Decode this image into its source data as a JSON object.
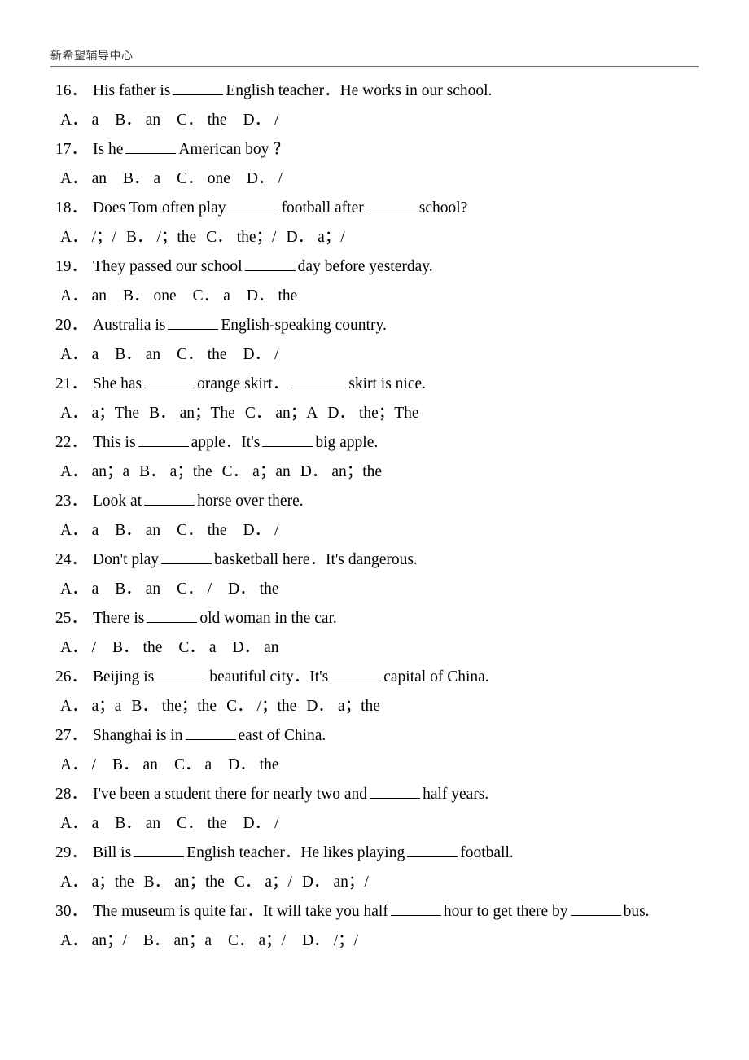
{
  "header": {
    "title": "新希望辅导中心"
  },
  "questions": [
    {
      "number": "16．",
      "stem_parts": [
        "His father is ",
        "blank",
        " English teacher．He works in our school."
      ],
      "blank_widths": [
        62
      ],
      "tight": false,
      "options": [
        {
          "label": "A．",
          "text": "a"
        },
        {
          "label": "B．",
          "text": "an"
        },
        {
          "label": "C．",
          "text": "the"
        },
        {
          "label": "D．",
          "text": "/"
        }
      ]
    },
    {
      "number": "17．",
      "stem_parts": [
        "Is he ",
        "blank",
        " American boy ？"
      ],
      "blank_widths": [
        62
      ],
      "tight": false,
      "options": [
        {
          "label": "A．",
          "text": "an"
        },
        {
          "label": "B．",
          "text": "a"
        },
        {
          "label": "C．",
          "text": "one"
        },
        {
          "label": "D．",
          "text": "/"
        }
      ]
    },
    {
      "number": "18．",
      "stem_parts": [
        "Does Tom often play ",
        "blank",
        " football after ",
        "blank",
        " school?"
      ],
      "blank_widths": [
        62,
        62
      ],
      "tight": true,
      "options": [
        {
          "label": "A．",
          "text": "/；/"
        },
        {
          "label": "B．",
          "text": "/；the"
        },
        {
          "label": "C．",
          "text": "the；/"
        },
        {
          "label": "D．",
          "text": "a；/"
        }
      ]
    },
    {
      "number": "19．",
      "stem_parts": [
        "They passed our school ",
        "blank",
        " day before yesterday."
      ],
      "blank_widths": [
        62
      ],
      "tight": false,
      "options": [
        {
          "label": "A．",
          "text": "an"
        },
        {
          "label": "B．",
          "text": "one"
        },
        {
          "label": "C．",
          "text": "a"
        },
        {
          "label": "D．",
          "text": "the"
        }
      ]
    },
    {
      "number": "20．",
      "stem_parts": [
        "Australia is ",
        "blank",
        " English-speaking country."
      ],
      "blank_widths": [
        62
      ],
      "tight": false,
      "options": [
        {
          "label": "A．",
          "text": "a"
        },
        {
          "label": "B．",
          "text": "an"
        },
        {
          "label": "C．",
          "text": "the"
        },
        {
          "label": "D．",
          "text": "/"
        }
      ]
    },
    {
      "number": "21．",
      "stem_parts": [
        "She has ",
        "blank",
        " orange skirt．",
        "blank",
        " skirt is nice."
      ],
      "blank_widths": [
        62,
        68
      ],
      "tight": true,
      "options": [
        {
          "label": "A．",
          "text": "a；The"
        },
        {
          "label": "B．",
          "text": "an；The"
        },
        {
          "label": "C．",
          "text": "an；A"
        },
        {
          "label": "D．",
          "text": "the；The"
        }
      ]
    },
    {
      "number": "22．",
      "stem_parts": [
        "This is ",
        "blank",
        " apple．It's ",
        "blank",
        " big apple."
      ],
      "blank_widths": [
        62,
        62
      ],
      "tight": true,
      "options": [
        {
          "label": "A．",
          "text": "an；a"
        },
        {
          "label": "B．",
          "text": "a；the"
        },
        {
          "label": "C．",
          "text": "a；an"
        },
        {
          "label": "D．",
          "text": "an；the"
        }
      ]
    },
    {
      "number": "23．",
      "stem_parts": [
        "Look at ",
        "blank",
        " horse over there."
      ],
      "blank_widths": [
        62
      ],
      "tight": false,
      "options": [
        {
          "label": "A．",
          "text": "a"
        },
        {
          "label": "B．",
          "text": "an"
        },
        {
          "label": "C．",
          "text": "the"
        },
        {
          "label": "D．",
          "text": "/"
        }
      ]
    },
    {
      "number": "24．",
      "stem_parts": [
        "Don't play ",
        "blank",
        " basketball here．It's dangerous."
      ],
      "blank_widths": [
        62
      ],
      "tight": false,
      "options": [
        {
          "label": "A．",
          "text": "a"
        },
        {
          "label": "B．",
          "text": "an"
        },
        {
          "label": "C．",
          "text": "/"
        },
        {
          "label": "D．",
          "text": "the"
        }
      ]
    },
    {
      "number": "25．",
      "stem_parts": [
        "There is ",
        "blank",
        " old woman in the car."
      ],
      "blank_widths": [
        62
      ],
      "tight": false,
      "options": [
        {
          "label": "A．",
          "text": "/"
        },
        {
          "label": "B．",
          "text": "the"
        },
        {
          "label": "C．",
          "text": "a"
        },
        {
          "label": "D．",
          "text": "an"
        }
      ]
    },
    {
      "number": "26．",
      "stem_parts": [
        "Beijing is ",
        "blank",
        " beautiful city．It's ",
        "blank",
        " capital of China."
      ],
      "blank_widths": [
        62,
        62
      ],
      "tight": true,
      "options": [
        {
          "label": "A．",
          "text": "a；a"
        },
        {
          "label": "B．",
          "text": "the；the"
        },
        {
          "label": "C．",
          "text": "/；the"
        },
        {
          "label": "D．",
          "text": "a；the"
        }
      ]
    },
    {
      "number": "27．",
      "stem_parts": [
        "Shanghai is in ",
        "blank",
        " east of China."
      ],
      "blank_widths": [
        62
      ],
      "tight": false,
      "options": [
        {
          "label": "A．",
          "text": "/"
        },
        {
          "label": "B．",
          "text": "an"
        },
        {
          "label": "C．",
          "text": "a"
        },
        {
          "label": "D．",
          "text": "the"
        }
      ]
    },
    {
      "number": "28．",
      "stem_parts": [
        "I've been a student there for nearly two and ",
        "blank",
        " half years."
      ],
      "blank_widths": [
        62
      ],
      "tight": false,
      "options": [
        {
          "label": "A．",
          "text": "a"
        },
        {
          "label": "B．",
          "text": "an"
        },
        {
          "label": "C．",
          "text": "the"
        },
        {
          "label": "D．",
          "text": "/"
        }
      ]
    },
    {
      "number": "29．",
      "stem_parts": [
        "Bill is ",
        "blank",
        " English teacher．He likes playing ",
        "blank",
        " football."
      ],
      "blank_widths": [
        62,
        62
      ],
      "tight": true,
      "options": [
        {
          "label": "A．",
          "text": "a；the"
        },
        {
          "label": "B．",
          "text": "an；the"
        },
        {
          "label": "C．",
          "text": "a；/"
        },
        {
          "label": "D．",
          "text": "an；/"
        }
      ]
    },
    {
      "number": "30．",
      "stem_parts": [
        "The museum is quite far．It will take you half ",
        "blank",
        " hour to get there by ",
        "blank",
        " bus."
      ],
      "blank_widths": [
        62,
        62
      ],
      "tight": false,
      "options": [
        {
          "label": "A．",
          "text": "an；/"
        },
        {
          "label": "B．",
          "text": "an；a"
        },
        {
          "label": "C．",
          "text": "a；/"
        },
        {
          "label": "D．",
          "text": "/；/"
        }
      ]
    }
  ]
}
